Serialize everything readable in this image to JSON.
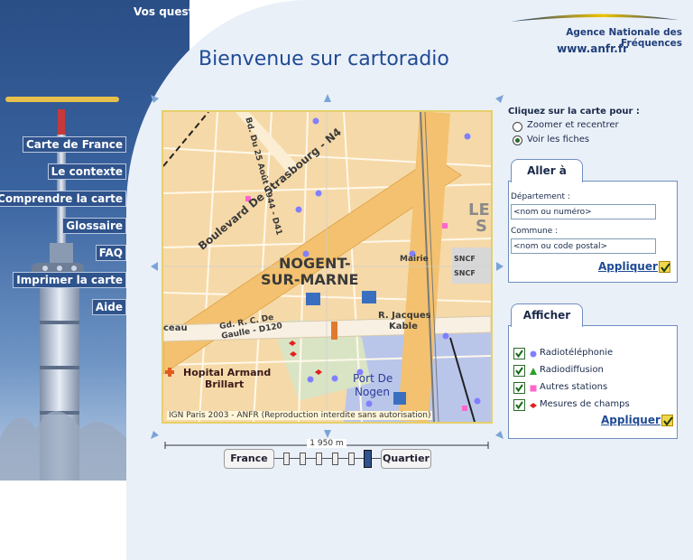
{
  "header": {
    "vos_questions": "Vos questions",
    "agency": "Agence Nationale des Fréquences",
    "url": "www.anfr.fr",
    "title": "Bienvenue sur cartoradio"
  },
  "nav": [
    "Carte de France",
    "Le contexte",
    "Comprendre la carte",
    "Glossaire",
    "FAQ",
    "Imprimer la carte",
    "Aide"
  ],
  "map": {
    "copyright": "IGN Paris 2003 - ANFR (Reproduction interdite sans autorisation)",
    "labels": {
      "town1": "NOGENT-",
      "town2": "SUR-MARNE",
      "boulevard": "Boulevard De Strasbourg - N4",
      "bd25": "Bd. Du 25 Août 1944 - D41",
      "gaulle1": "Gd. R. C. De",
      "gaulle2": "Gaulle - D120",
      "jacques": "R. Jacques",
      "kable": "Kable",
      "hopital1": "Hopital Armand",
      "hopital2": "Brillart",
      "port1": "Port De",
      "port2": "Nogen",
      "mairie": "Mairie",
      "sncf": "SNCF",
      "eau": "ceau",
      "le": "LE",
      "s": "S"
    }
  },
  "scale": {
    "text": "1 950 m"
  },
  "zoom": {
    "left_label": "France",
    "right_label": "Quartier",
    "steps": 6,
    "selected": 6
  },
  "click_options": {
    "heading": "Cliquez sur la carte pour :",
    "options": [
      {
        "label": "Zoomer et recentrer",
        "selected": false
      },
      {
        "label": "Voir les fiches",
        "selected": true
      }
    ]
  },
  "aller": {
    "tab": "Aller à",
    "dept_label": "Département :",
    "dept_placeholder": "<nom ou numéro>",
    "commune_label": "Commune :",
    "commune_placeholder": "<nom ou code postal>",
    "apply": "Appliquer"
  },
  "afficher": {
    "tab": "Afficher",
    "apply": "Appliquer",
    "layers": [
      {
        "label": "Radiotéléphonie",
        "checked": true,
        "icon": "dot",
        "color": "#8080ff"
      },
      {
        "label": "Radiodiffusion",
        "checked": true,
        "icon": "triangle",
        "color": "#2aa02a"
      },
      {
        "label": "Autres stations",
        "checked": true,
        "icon": "square",
        "color": "#ff66cc"
      },
      {
        "label": "Mesures de champs",
        "checked": true,
        "icon": "diamond",
        "color": "#e02020"
      }
    ]
  },
  "colors": {
    "title": "#1f4b95",
    "map_bg": "#f6d9a8",
    "road": "#f3c16f",
    "water": "#b9c6ea"
  }
}
